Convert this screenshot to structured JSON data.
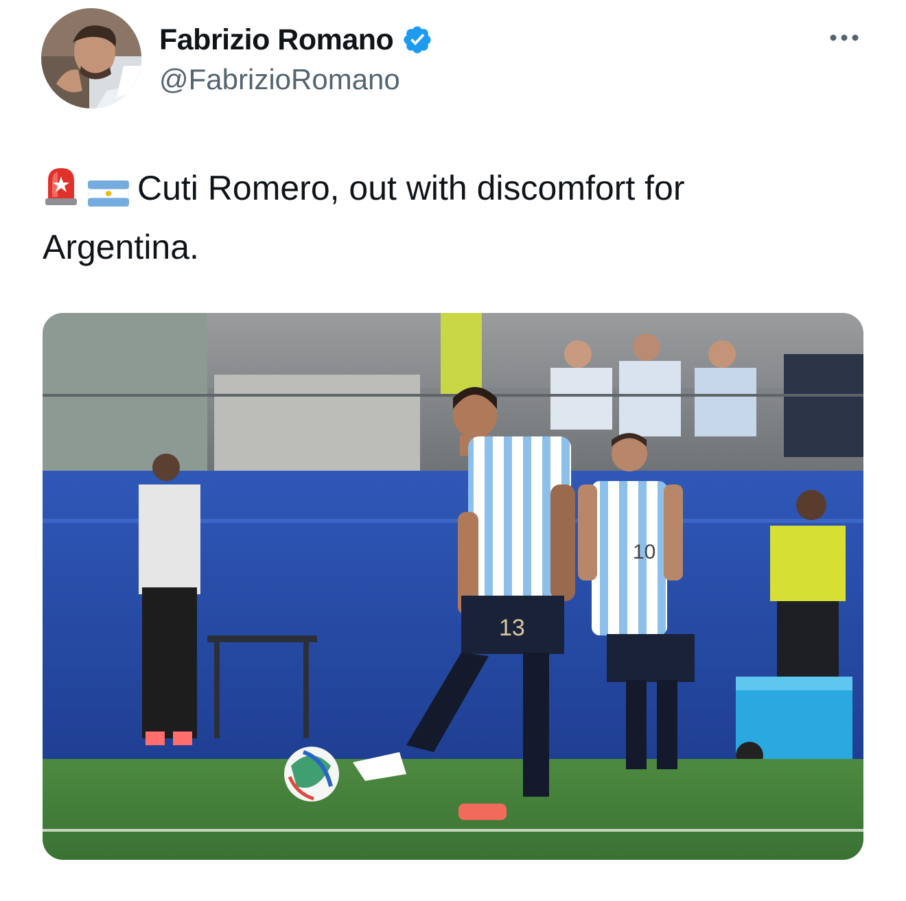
{
  "author": {
    "display_name": "Fabrizio Romano",
    "handle": "@FabrizioRomano",
    "verified": true,
    "avatar_icon": "profile-photo"
  },
  "tweet": {
    "emoji_1": "police-siren-icon",
    "emoji_2": "argentina-flag-icon",
    "text_line_1": "Cuti Romero, out with discomfort for",
    "text_line_2": "Argentina."
  },
  "media": {
    "description_icon": "football-match-photo",
    "player_1_number": "13",
    "player_2_number": "10"
  },
  "menu": {
    "icon": "more-options-icon"
  },
  "colors": {
    "verified_blue": "#1d9bf0",
    "handle_gray": "#536471",
    "pitch_green": "#3f7f3a",
    "board_blue": "#2a4fae"
  }
}
